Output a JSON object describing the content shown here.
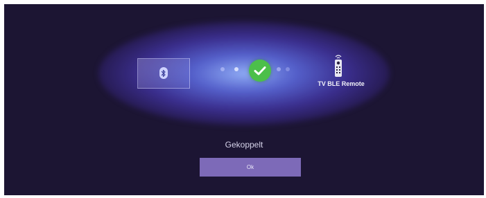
{
  "pairing": {
    "source_icon": "bluetooth-icon",
    "status_icon": "checkmark-icon",
    "target_icon": "remote-control-icon",
    "device_name": "TV BLE Remote",
    "status_text": "Gekoppelt"
  },
  "actions": {
    "ok_label": "Ok"
  },
  "colors": {
    "background": "#1c1533",
    "glow": "#6a78e6",
    "success": "#4cbf4a",
    "button": "#7d6ab8"
  }
}
